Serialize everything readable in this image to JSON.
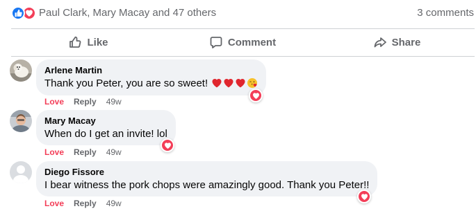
{
  "summary": {
    "reaction_types": [
      "like",
      "love"
    ],
    "names": "Paul Clark, Mary Macay and 47 others",
    "comments_count": "3 comments"
  },
  "actions": {
    "like": "Like",
    "comment": "Comment",
    "share": "Share"
  },
  "colors": {
    "like_blue": "#1877f2",
    "love_red": "#f33e58",
    "bubble_bg": "#f0f2f5",
    "muted_text": "#65676b"
  },
  "comments": [
    {
      "author": "Arlene Martin",
      "text": "Thank you Peter, you are so sweet!",
      "emojis": [
        "red-heart-emoji",
        "red-heart-emoji",
        "red-heart-emoji",
        "face-blowing-kiss-emoji"
      ],
      "love_label": "Love",
      "reply_label": "Reply",
      "time": "49w",
      "reaction": "love"
    },
    {
      "author": "Mary Macay",
      "text": "When do I get an invite! lol",
      "love_label": "Love",
      "reply_label": "Reply",
      "time": "49w",
      "reaction": "love"
    },
    {
      "author": "Diego Fissore",
      "text": "I bear witness the pork chops were amazingly good. Thank you Peter!!",
      "love_label": "Love",
      "reply_label": "Reply",
      "time": "49w",
      "reaction": "love"
    }
  ]
}
